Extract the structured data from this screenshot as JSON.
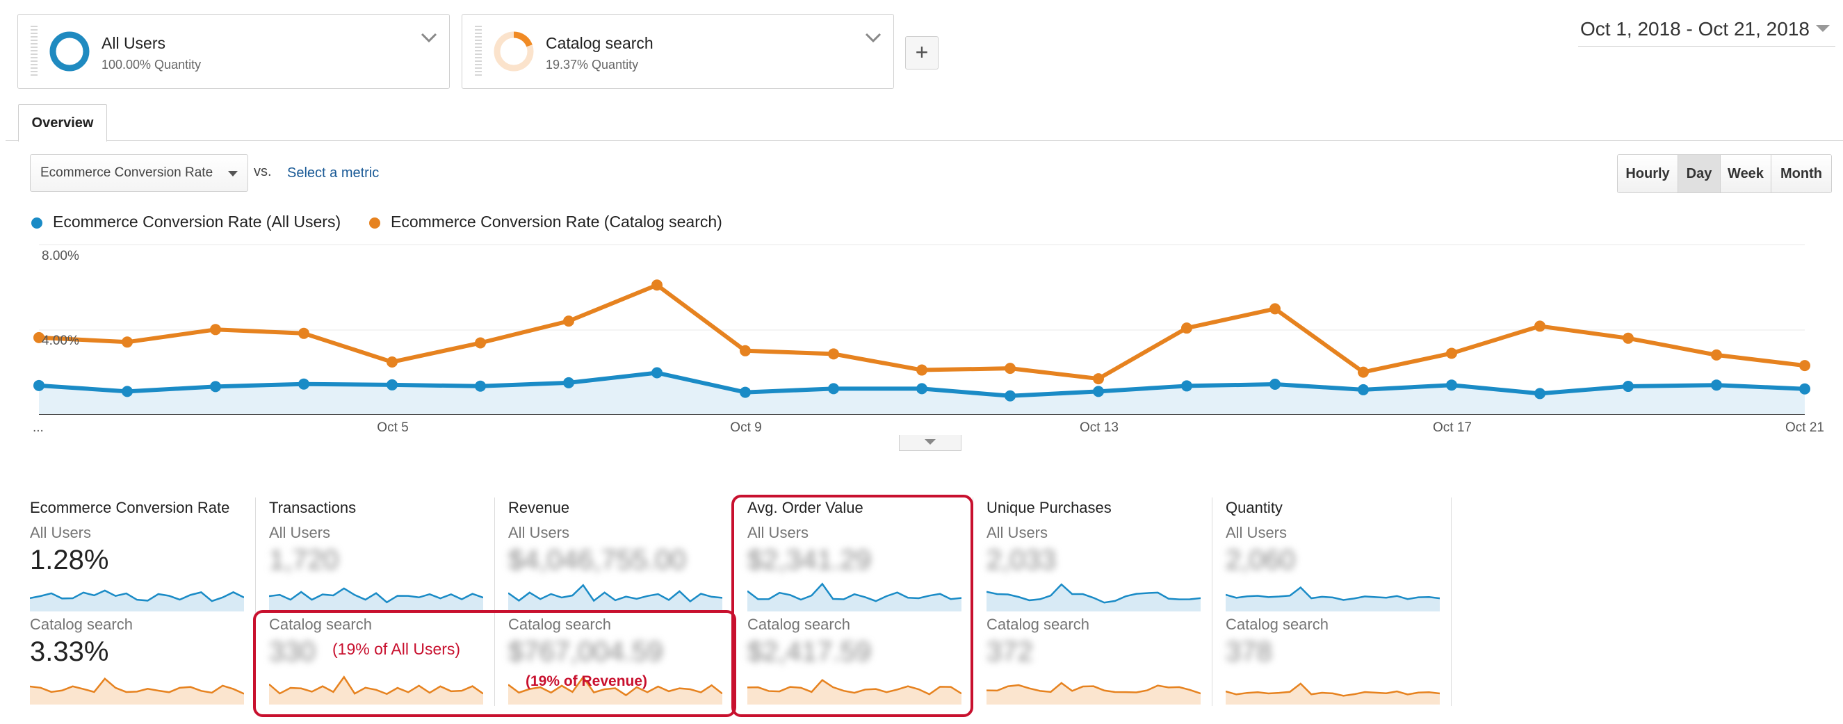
{
  "segments": [
    {
      "name": "All Users",
      "sub": "100.00% Quantity",
      "pct": 1.0,
      "color": "#1f8ac0"
    },
    {
      "name": "Catalog search",
      "sub": "19.37% Quantity",
      "pct": 0.1937,
      "color": "#f08a24"
    }
  ],
  "add_segment_label": "+",
  "date_range": "Oct 1, 2018 - Oct 21, 2018",
  "tabs": [
    {
      "label": "Overview"
    }
  ],
  "metric_selector": {
    "selected": "Ecommerce Conversion Rate",
    "vs_label": "vs.",
    "select_metric_label": "Select a metric"
  },
  "period_buttons": [
    {
      "label": "Hourly",
      "active": false
    },
    {
      "label": "Day",
      "active": true
    },
    {
      "label": "Week",
      "active": false
    },
    {
      "label": "Month",
      "active": false
    }
  ],
  "colors": {
    "all_users": "#1a8bc6",
    "catalog": "#e6821f",
    "highlight": "#c8102e"
  },
  "chart_data": {
    "type": "line",
    "x": [
      "Oct 1",
      "Oct 2",
      "Oct 3",
      "Oct 4",
      "Oct 5",
      "Oct 6",
      "Oct 7",
      "Oct 8",
      "Oct 9",
      "Oct 10",
      "Oct 11",
      "Oct 12",
      "Oct 13",
      "Oct 14",
      "Oct 15",
      "Oct 16",
      "Oct 17",
      "Oct 18",
      "Oct 19",
      "Oct 20",
      "Oct 21"
    ],
    "x_tick_labels": [
      "...",
      "Oct 5",
      "Oct 9",
      "Oct 13",
      "Oct 17",
      "Oct 21"
    ],
    "y_tick_labels": [
      "8.00%",
      "4.00%"
    ],
    "ylim": [
      0,
      8
    ],
    "grid": true,
    "legend_position": "top-left",
    "series": [
      {
        "name": "Ecommerce Conversion Rate (All Users)",
        "values": [
          1.35,
          1.07,
          1.3,
          1.42,
          1.38,
          1.32,
          1.48,
          1.95,
          1.03,
          1.2,
          1.2,
          0.86,
          1.07,
          1.33,
          1.41,
          1.15,
          1.37,
          0.97,
          1.31,
          1.37,
          1.19
        ]
      },
      {
        "name": "Ecommerce Conversion Rate (Catalog search)",
        "values": [
          3.61,
          3.4,
          3.99,
          3.81,
          2.46,
          3.36,
          4.39,
          6.09,
          2.99,
          2.84,
          2.08,
          2.16,
          1.67,
          4.06,
          4.97,
          1.98,
          2.87,
          4.15,
          3.58,
          2.79,
          2.29
        ]
      }
    ]
  },
  "scorecards": [
    {
      "title": "Ecommerce Conversion Rate",
      "all_label": "All Users",
      "all_value": "1.28%",
      "cat_label": "Catalog search",
      "cat_value": "3.33%",
      "blurred": false
    },
    {
      "title": "Transactions",
      "all_label": "All Users",
      "all_value": "1,720",
      "cat_label": "Catalog search",
      "cat_value": "330",
      "blurred": true
    },
    {
      "title": "Revenue",
      "all_label": "All Users",
      "all_value": "$4,046,755.00",
      "cat_label": "Catalog search",
      "cat_value": "$767,004.59",
      "blurred": true
    },
    {
      "title": "Avg. Order Value",
      "all_label": "All Users",
      "all_value": "$2,341.29",
      "cat_label": "Catalog search",
      "cat_value": "$2,417.59",
      "blurred": true
    },
    {
      "title": "Unique Purchases",
      "all_label": "All Users",
      "all_value": "2,033",
      "cat_label": "Catalog search",
      "cat_value": "372",
      "blurred": true
    },
    {
      "title": "Quantity",
      "all_label": "All Users",
      "all_value": "2,060",
      "cat_label": "Catalog search",
      "cat_value": "378",
      "blurred": true
    }
  ],
  "annotations": {
    "transactions_note": "(19% of All Users)",
    "revenue_note": "(19% of Revenue)"
  }
}
